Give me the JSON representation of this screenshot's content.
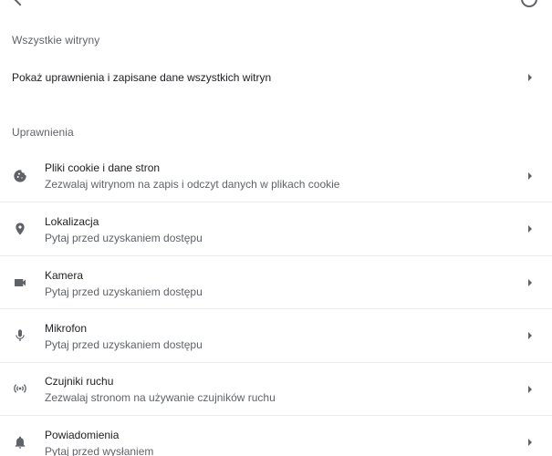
{
  "all_sites": {
    "heading": "Wszystkie witryny",
    "item_label": "Pokaż uprawnienia i zapisane dane wszystkich witryn"
  },
  "permissions": {
    "heading": "Uprawnienia",
    "items": [
      {
        "icon": "cookie-icon",
        "title": "Pliki cookie i dane stron",
        "subtitle": "Zezwalaj witrynom na zapis i odczyt danych w plikach cookie"
      },
      {
        "icon": "location-pin-icon",
        "title": "Lokalizacja",
        "subtitle": "Pytaj przed uzyskaniem dostępu"
      },
      {
        "icon": "camera-icon",
        "title": "Kamera",
        "subtitle": "Pytaj przed uzyskaniem dostępu"
      },
      {
        "icon": "microphone-icon",
        "title": "Mikrofon",
        "subtitle": "Pytaj przed uzyskaniem dostępu"
      },
      {
        "icon": "motion-sensors-icon",
        "title": "Czujniki ruchu",
        "subtitle": "Zezwalaj stronom na używanie czujników ruchu"
      },
      {
        "icon": "bell-icon",
        "title": "Powiadomienia",
        "subtitle": "Pytaj przed wysłaniem"
      }
    ]
  },
  "colors": {
    "text_primary": "#202124",
    "text_secondary": "#5f6368",
    "divider": "#e8eaed",
    "icon": "#5f6368"
  }
}
